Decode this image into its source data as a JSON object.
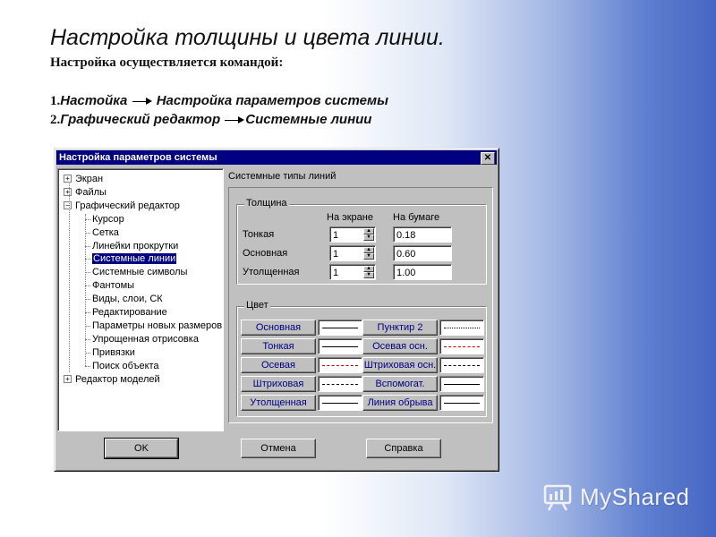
{
  "slide": {
    "title": "Настройка толщины и цвета линии.",
    "subtitle": "Настройка осуществляется командой:",
    "step1": {
      "num": "1.",
      "a": "Настойка",
      "b": "Настройка параметров системы"
    },
    "step2": {
      "num": "2.",
      "a": "Графический редактор",
      "b": "Системные линии"
    }
  },
  "dialog": {
    "title": "Настройка параметров системы",
    "close": "✕",
    "tree": [
      {
        "label": "Экран",
        "expander": "+"
      },
      {
        "label": "Файлы",
        "expander": "+"
      },
      {
        "label": "Графический редактор",
        "expander": "−"
      },
      {
        "label": "Курсор"
      },
      {
        "label": "Сетка"
      },
      {
        "label": "Линейки прокрутки"
      },
      {
        "label": "Системные линии",
        "selected": true
      },
      {
        "label": "Системные символы"
      },
      {
        "label": "Фантомы"
      },
      {
        "label": "Виды, слои, СК"
      },
      {
        "label": "Редактирование"
      },
      {
        "label": "Параметры новых размеров"
      },
      {
        "label": "Упрощенная отрисовка"
      },
      {
        "label": "Привязки"
      },
      {
        "label": "Поиск объекта"
      },
      {
        "label": "Редактор моделей",
        "expander": "+"
      }
    ],
    "panel_title": "Системные типы линий",
    "thickness": {
      "group": "Толщина",
      "col_screen": "На экране",
      "col_paper": "На бумаге",
      "rows": [
        {
          "label": "Тонкая",
          "screen": "1",
          "paper": "0.18"
        },
        {
          "label": "Основная",
          "screen": "1",
          "paper": "0.60"
        },
        {
          "label": "Утолщенная",
          "screen": "1",
          "paper": "1.00"
        }
      ]
    },
    "color": {
      "group": "Цвет",
      "left": [
        "Основная",
        "Тонкая",
        "Осевая",
        "Штриховая",
        "Утолщенная"
      ],
      "right": [
        "Пунктир 2",
        "Осевая осн.",
        "Штриховая осн.",
        "Вспомогат.",
        "Линия обрыва"
      ]
    },
    "buttons": {
      "ok": "OK",
      "cancel": "Отмена",
      "help": "Справка"
    }
  },
  "logo": {
    "text": "MyShared"
  }
}
